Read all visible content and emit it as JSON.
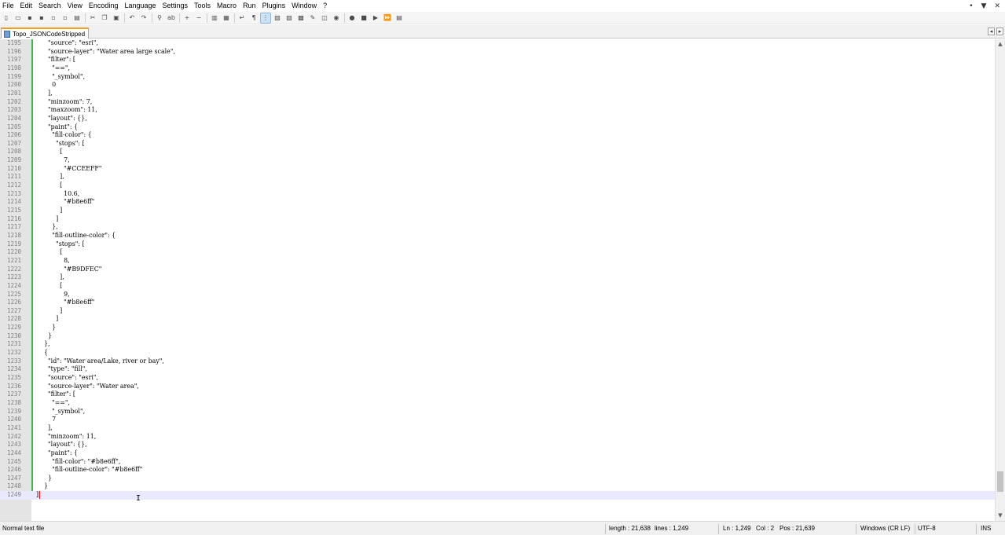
{
  "menu": [
    "File",
    "Edit",
    "Search",
    "View",
    "Encoding",
    "Language",
    "Settings",
    "Tools",
    "Macro",
    "Run",
    "Plugins",
    "Window",
    "?"
  ],
  "window_controls": [
    "•",
    "▼",
    "✕"
  ],
  "toolbar": {
    "buttons": [
      {
        "name": "new-file-icon",
        "glyph": "▯"
      },
      {
        "name": "open-file-icon",
        "glyph": "▭"
      },
      {
        "name": "save-icon",
        "glyph": "▪"
      },
      {
        "name": "save-all-icon",
        "glyph": "▪"
      },
      {
        "name": "close-icon",
        "glyph": "▫"
      },
      {
        "name": "close-all-icon",
        "glyph": "▫"
      },
      {
        "name": "print-icon",
        "glyph": "▤"
      },
      "sep",
      {
        "name": "cut-icon",
        "glyph": "✂"
      },
      {
        "name": "copy-icon",
        "glyph": "❐"
      },
      {
        "name": "paste-icon",
        "glyph": "▣"
      },
      "sep",
      {
        "name": "undo-icon",
        "glyph": "↶"
      },
      {
        "name": "redo-icon",
        "glyph": "↷"
      },
      "sep",
      {
        "name": "find-icon",
        "glyph": "⚲"
      },
      {
        "name": "replace-icon",
        "glyph": "ab"
      },
      "sep",
      {
        "name": "zoom-in-icon",
        "glyph": "+"
      },
      {
        "name": "zoom-out-icon",
        "glyph": "−"
      },
      "sep",
      {
        "name": "sync-vertical-icon",
        "glyph": "▥"
      },
      {
        "name": "sync-horizontal-icon",
        "glyph": "▦"
      },
      "sep",
      {
        "name": "word-wrap-icon",
        "glyph": "↵"
      },
      {
        "name": "show-all-chars-icon",
        "glyph": "¶"
      },
      {
        "name": "indent-guide-icon",
        "glyph": "⋮",
        "active": true
      },
      {
        "name": "language-udl-icon",
        "glyph": "▧"
      },
      {
        "name": "doc-map-icon",
        "glyph": "▨"
      },
      {
        "name": "function-list-icon",
        "glyph": "▩"
      },
      {
        "name": "folder-workspace-icon",
        "glyph": "✎"
      },
      {
        "name": "monitoring-icon",
        "glyph": "◫"
      },
      {
        "name": "view-icon",
        "glyph": "◉"
      },
      "sep",
      {
        "name": "record-macro-icon",
        "glyph": "●"
      },
      {
        "name": "stop-macro-icon",
        "glyph": "■"
      },
      {
        "name": "play-macro-icon",
        "glyph": "▶"
      },
      {
        "name": "run-macro-multiple-icon",
        "glyph": "⏩"
      },
      {
        "name": "save-macro-icon",
        "glyph": "▤"
      }
    ]
  },
  "tab": {
    "label": "Topo_JSONCodeStripped"
  },
  "tab_nav": [
    "◂",
    "▸",
    "✕"
  ],
  "editor": {
    "current_line": 1249,
    "lines": [
      {
        "n": "1195",
        "t": "      \"source\": \"esri\","
      },
      {
        "n": "1196",
        "t": "      \"source-layer\": \"Water area large scale\","
      },
      {
        "n": "1197",
        "t": "      \"filter\": ["
      },
      {
        "n": "1198",
        "t": "        \"==\","
      },
      {
        "n": "1199",
        "t": "        \"_symbol\","
      },
      {
        "n": "1200",
        "t": "        0"
      },
      {
        "n": "1201",
        "t": "      ],"
      },
      {
        "n": "1202",
        "t": "      \"minzoom\": 7,"
      },
      {
        "n": "1203",
        "t": "      \"maxzoom\": 11,"
      },
      {
        "n": "1204",
        "t": "      \"layout\": {},"
      },
      {
        "n": "1205",
        "t": "      \"paint\": {"
      },
      {
        "n": "1206",
        "t": "        \"fill-color\": {"
      },
      {
        "n": "1207",
        "t": "          \"stops\": ["
      },
      {
        "n": "1208",
        "t": "            ["
      },
      {
        "n": "1209",
        "t": "              7,"
      },
      {
        "n": "1210",
        "t": "              \"#CCEEFF\""
      },
      {
        "n": "1211",
        "t": "            ],"
      },
      {
        "n": "1212",
        "t": "            ["
      },
      {
        "n": "1213",
        "t": "              10.6,"
      },
      {
        "n": "1214",
        "t": "              \"#b8e6ff\""
      },
      {
        "n": "1215",
        "t": "            ]"
      },
      {
        "n": "1216",
        "t": "          ]"
      },
      {
        "n": "1217",
        "t": "        },"
      },
      {
        "n": "1218",
        "t": "        \"fill-outline-color\": {"
      },
      {
        "n": "1219",
        "t": "          \"stops\": ["
      },
      {
        "n": "1220",
        "t": "            ["
      },
      {
        "n": "1221",
        "t": "              8,"
      },
      {
        "n": "1222",
        "t": "              \"#B9DFEC\""
      },
      {
        "n": "1223",
        "t": "            ],"
      },
      {
        "n": "1224",
        "t": "            ["
      },
      {
        "n": "1225",
        "t": "              9,"
      },
      {
        "n": "1226",
        "t": "              \"#b8e6ff\""
      },
      {
        "n": "1227",
        "t": "            ]"
      },
      {
        "n": "1228",
        "t": "          ]"
      },
      {
        "n": "1229",
        "t": "        }"
      },
      {
        "n": "1230",
        "t": "      }"
      },
      {
        "n": "1231",
        "t": "    },"
      },
      {
        "n": "1232",
        "t": "    {"
      },
      {
        "n": "1233",
        "t": "      \"id\": \"Water area/Lake, river or bay\","
      },
      {
        "n": "1234",
        "t": "      \"type\": \"fill\","
      },
      {
        "n": "1235",
        "t": "      \"source\": \"esri\","
      },
      {
        "n": "1236",
        "t": "      \"source-layer\": \"Water area\","
      },
      {
        "n": "1237",
        "t": "      \"filter\": ["
      },
      {
        "n": "1238",
        "t": "        \"==\","
      },
      {
        "n": "1239",
        "t": "        \"_symbol\","
      },
      {
        "n": "1240",
        "t": "        7"
      },
      {
        "n": "1241",
        "t": "      ],"
      },
      {
        "n": "1242",
        "t": "      \"minzoom\": 11,"
      },
      {
        "n": "1243",
        "t": "      \"layout\": {},"
      },
      {
        "n": "1244",
        "t": "      \"paint\": {"
      },
      {
        "n": "1245",
        "t": "        \"fill-color\": \"#b8e6ff\","
      },
      {
        "n": "1246",
        "t": "        \"fill-outline-color\": \"#b8e6ff\""
      },
      {
        "n": "1247",
        "t": "      }"
      },
      {
        "n": "1248",
        "t": "    }"
      },
      {
        "n": "1249",
        "t": "]"
      }
    ]
  },
  "scrollbar": {
    "up": "▲",
    "down": "▼"
  },
  "status": {
    "file_type": "Normal text file",
    "length": "length : 21,638",
    "lines": "lines : 1,249",
    "ln": "Ln : 1,249",
    "col": "Col : 2",
    "pos": "Pos : 21,639",
    "eol": "Windows (CR LF)",
    "encoding": "UTF-8",
    "mode": "INS"
  },
  "colors": {
    "gutter": "#e4e4e4",
    "change_bar": "#3eb84a",
    "current_line": "#e8e8ff",
    "tab_accent": "#f0a020"
  }
}
